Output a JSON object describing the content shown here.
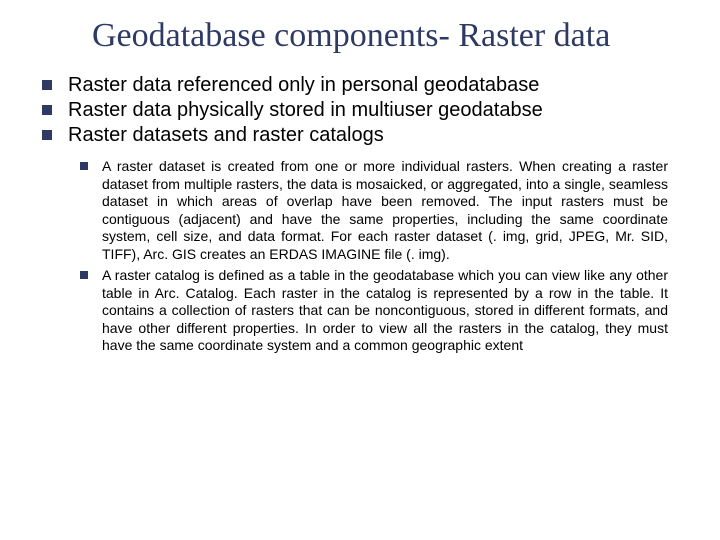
{
  "title": "Geodatabase components- Raster data",
  "bullets": [
    "Raster data referenced only in personal geodatabase",
    "Raster data physically stored in multiuser geodatabse",
    "Raster datasets and raster catalogs"
  ],
  "subbullets": [
    "A raster dataset is created from one or more individual rasters. When creating a raster dataset from multiple rasters, the data is mosaicked, or aggregated, into a single, seamless dataset in which areas of overlap have been removed. The input rasters must be contiguous (adjacent) and have the same properties, including the same coordinate system, cell size, and data format. For each raster dataset (. img, grid, JPEG, Mr. SID, TIFF), Arc. GIS creates an ERDAS IMAGINE file (. img).",
    "A raster catalog is defined as a table in the geodatabase which you can view like any other table in Arc. Catalog. Each raster in the catalog is represented by a row in the table. It contains a collection of rasters that can be noncontiguous, stored in different formats, and have other different properties. In order to view all the rasters in the catalog, they must have the same coordinate system and a common geographic extent"
  ]
}
